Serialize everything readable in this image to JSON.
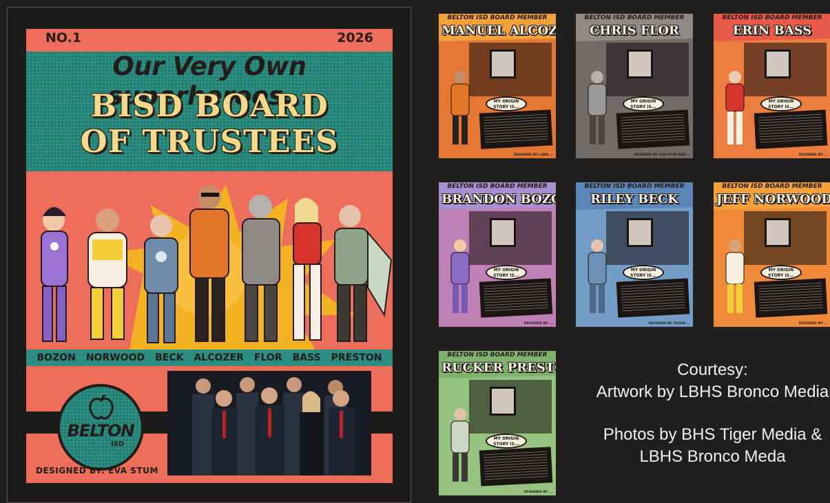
{
  "cover": {
    "issue_number": "NO.1",
    "year": "2026",
    "tagline": "Our Very Own superheroes...",
    "title_line1": "BISD BOARD",
    "title_line2": "OF TRUSTEES",
    "hero_names": [
      "BOZON",
      "NORWOOD",
      "BECK",
      "ALCOZER",
      "FLOR",
      "BASS",
      "PRESTON"
    ],
    "logo_text": "BELTON",
    "logo_sub": "ISD",
    "designed_by": "DESIGNED BY: EVA STUM"
  },
  "thumbnails": [
    {
      "top_label": "BELTON ISD BOARD MEMBER",
      "name": "MANUEL ALCOZER",
      "bubble": "MY ORIGIN STORY IS...",
      "bg": "#f2a13b",
      "accent": "#d8562f",
      "hero": "#e2772a",
      "credit": "DESIGNED BY: LARA ..."
    },
    {
      "top_label": "BELTON ISD BOARD MEMBER",
      "name": "CHRIS FLOR",
      "bubble": "MY ORIGIN STORY IS...",
      "bg": "#8d8a88",
      "accent": "#5c5957",
      "hero": "#9a9896",
      "credit": "DESIGNED BY: EVA STUM AND ..."
    },
    {
      "top_label": "BELTON ISD BOARD MEMBER",
      "name": "ERIN BASS",
      "bubble": "MY ORIGIN STORY IS...",
      "bg": "#e85b4a",
      "accent": "#f0a032",
      "hero": "#f5efe6",
      "credit": "DESIGNED BY: ..."
    },
    {
      "top_label": "BELTON ISD BOARD MEMBER",
      "name": "BRANDON BOZON",
      "bubble": "MY ORIGIN STORY IS...",
      "bg": "#a88fd0",
      "accent": "#e06a8f",
      "hero": "#8c6cc9",
      "credit": "DESIGNED BY: ..."
    },
    {
      "top_label": "BELTON ISD BOARD MEMBER",
      "name": "RILEY BECK",
      "bubble": "MY ORIGIN STORY IS...",
      "bg": "#5d86b8",
      "accent": "#8fb7da",
      "hero": "#6c8fb3",
      "credit": "DESIGNED BY: OLIVIA ..."
    },
    {
      "top_label": "BELTON ISD BOARD MEMBER",
      "name": "JEFF NORWOOD",
      "bubble": "MY ORIGIN STORY IS...",
      "bg": "#f2a13b",
      "accent": "#e86f3a",
      "hero": "#f4ce38",
      "credit": "DESIGNED BY: ..."
    },
    {
      "top_label": "BELTON ISD BOARD MEMBER",
      "name": "RUCKER PRESTON",
      "bubble": "MY ORIGIN STORY IS...",
      "bg": "#7fb36d",
      "accent": "#b5d69a",
      "hero": "#cfd8c4",
      "credit": "DESIGNED BY: ..."
    }
  ],
  "courtesy": {
    "line1": "Courtesy:",
    "line2": "Artwork by LBHS Bronco Media",
    "line3": "Photos by BHS Tiger Media &",
    "line4": "LBHS Bronco Meda"
  }
}
